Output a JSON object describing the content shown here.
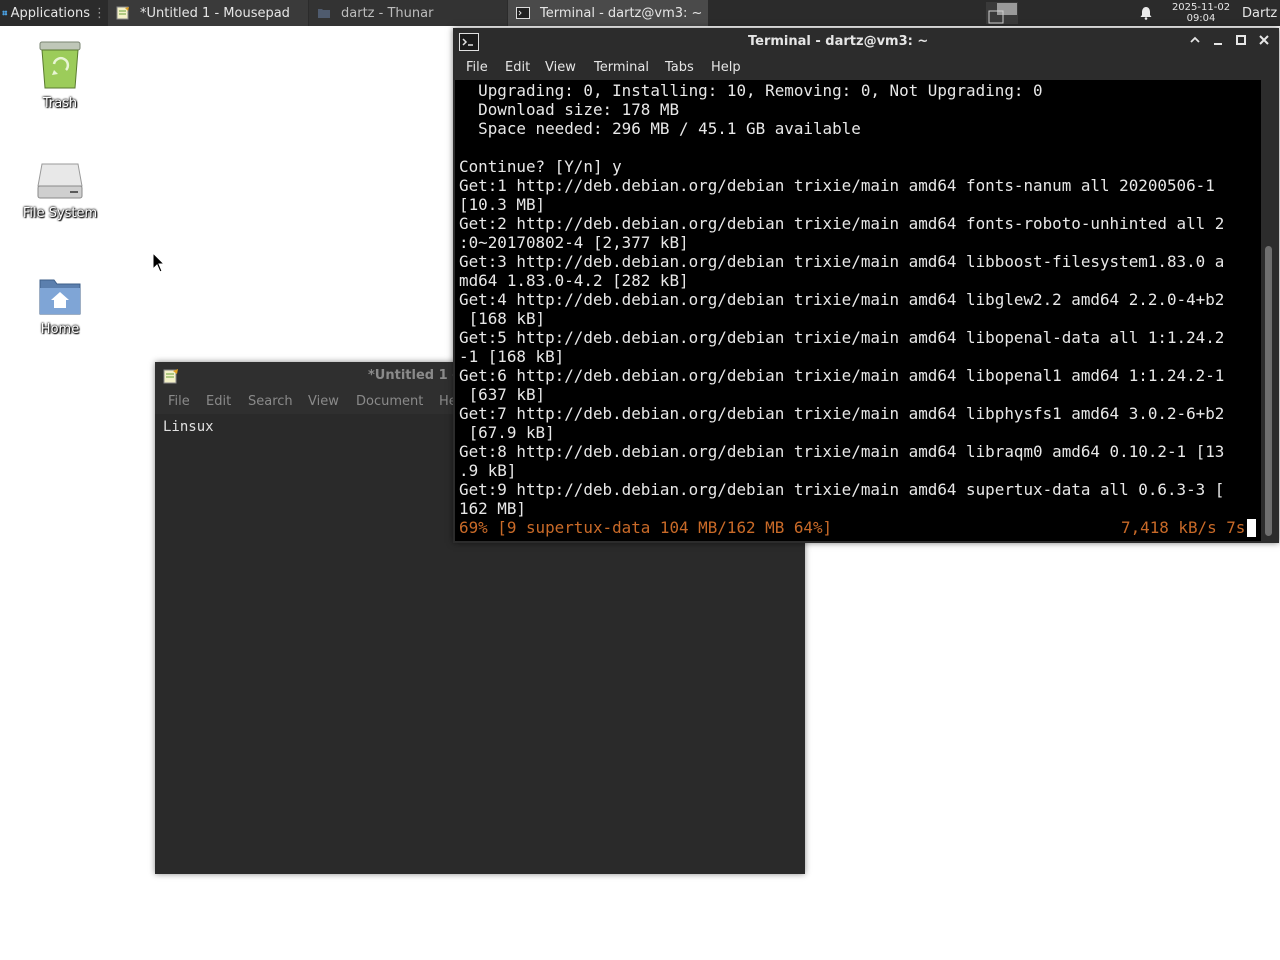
{
  "panel": {
    "applications_label": "Applications",
    "tasks": [
      {
        "label": "*Untitled 1 - Mousepad"
      },
      {
        "label": "dartz - Thunar"
      },
      {
        "label": "Terminal - dartz@vm3: ~"
      }
    ],
    "clock_date": "2025-11-02",
    "clock_time": "09:04",
    "user": "Dartz"
  },
  "desktop": {
    "icons": [
      {
        "label": "Trash"
      },
      {
        "label": "File System"
      },
      {
        "label": "Home"
      }
    ]
  },
  "mousepad": {
    "title": "*Untitled 1 - Mousepad",
    "menu": [
      "File",
      "Edit",
      "Search",
      "View",
      "Document",
      "Help"
    ],
    "content": "Linsux"
  },
  "terminal": {
    "title": "Terminal - dartz@vm3: ~",
    "menu": [
      "File",
      "Edit",
      "View",
      "Terminal",
      "Tabs",
      "Help"
    ],
    "output": "  Upgrading: 0, Installing: 10, Removing: 0, Not Upgrading: 0\n  Download size: 178 MB\n  Space needed: 296 MB / 45.1 GB available\n\nContinue? [Y/n] y\nGet:1 http://deb.debian.org/debian trixie/main amd64 fonts-nanum all 20200506-1\n[10.3 MB]\nGet:2 http://deb.debian.org/debian trixie/main amd64 fonts-roboto-unhinted all 2\n:0~20170802-4 [2,377 kB]\nGet:3 http://deb.debian.org/debian trixie/main amd64 libboost-filesystem1.83.0 a\nmd64 1.83.0-4.2 [282 kB]\nGet:4 http://deb.debian.org/debian trixie/main amd64 libglew2.2 amd64 2.2.0-4+b2\n [168 kB]\nGet:5 http://deb.debian.org/debian trixie/main amd64 libopenal-data all 1:1.24.2\n-1 [168 kB]\nGet:6 http://deb.debian.org/debian trixie/main amd64 libopenal1 amd64 1:1.24.2-1\n [637 kB]\nGet:7 http://deb.debian.org/debian trixie/main amd64 libphysfs1 amd64 3.0.2-6+b2\n [67.9 kB]\nGet:8 http://deb.debian.org/debian trixie/main amd64 libraqm0 amd64 0.10.2-1 [13\n.9 kB]\nGet:9 http://deb.debian.org/debian trixie/main amd64 supertux-data all 0.6.3-3 [\n162 MB]",
    "progress_line": "69% [9 supertux-data 104 MB/162 MB 64%]",
    "rate_line": "7,418 kB/s 7s"
  },
  "colors": {
    "panel_bg": "#2b2b2b",
    "terminal_bg": "#000000",
    "terminal_fg": "#e8e8e8",
    "progress_fg": "#c96a28",
    "window_bg": "#2c2c2c"
  }
}
